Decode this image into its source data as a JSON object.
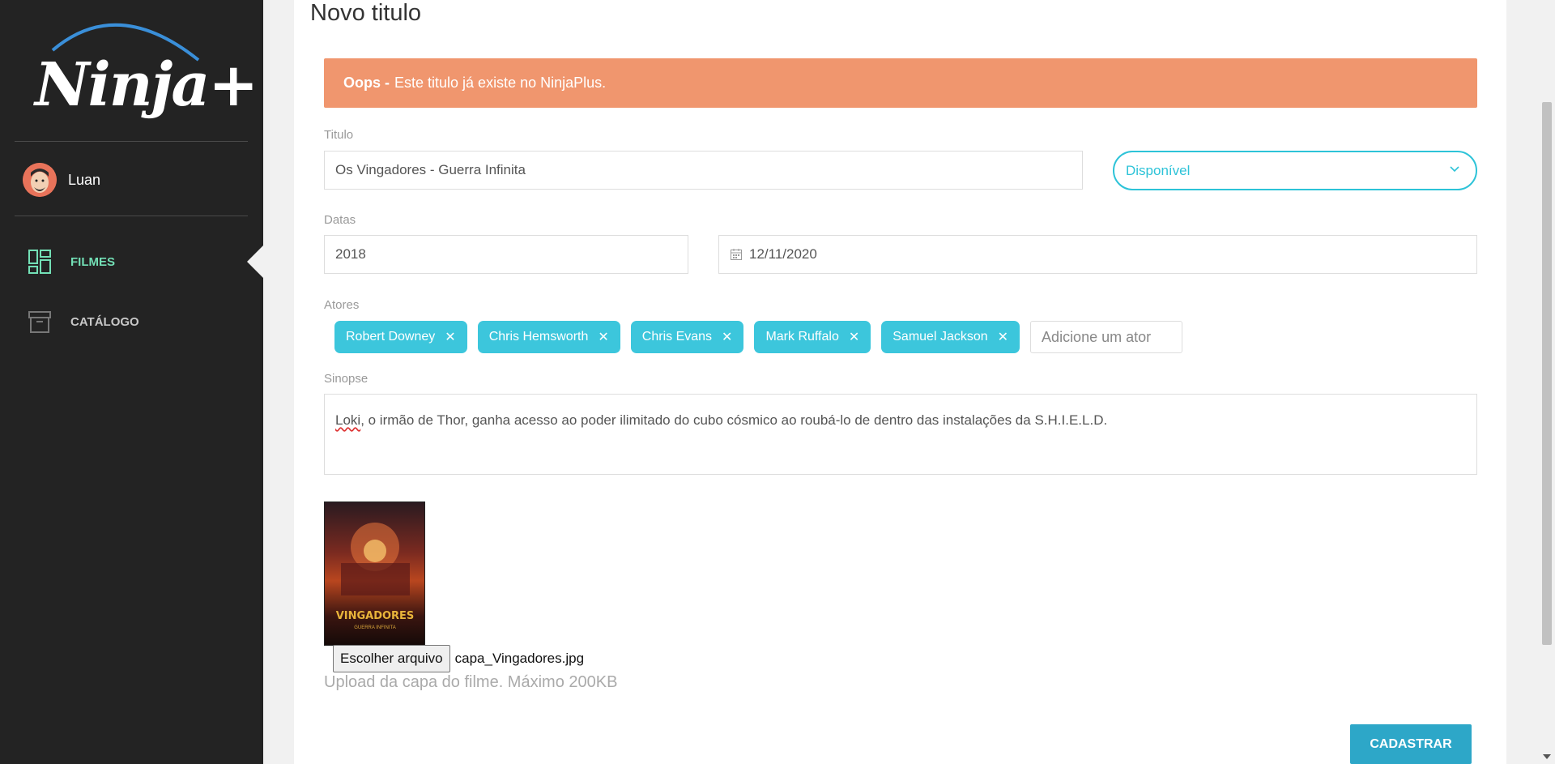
{
  "sidebar": {
    "logo_text": "Ninja+",
    "user_name": "Luan",
    "nav": [
      {
        "label": "FILMES",
        "icon": "dashboard-icon"
      },
      {
        "label": "CATÁLOGO",
        "icon": "archive-box-icon"
      }
    ]
  },
  "main": {
    "title": "Novo titulo",
    "alert": {
      "prefix": "Oops -",
      "message": "Este titulo já existe no NinjaPlus."
    },
    "titulo_label": "Titulo",
    "titulo_value": "Os Vingadores - Guerra Infinita",
    "status_value": "Disponível",
    "datas_label": "Datas",
    "year_value": "2018",
    "date_value": "12/11/2020",
    "atores_label": "Atores",
    "actors": [
      "Robert Downey",
      "Chris Hemsworth",
      "Chris Evans",
      "Mark Ruffalo",
      "Samuel Jackson"
    ],
    "actor_placeholder": "Adicione um ator",
    "sinopse_label": "Sinopse",
    "sinopse_first_word": "Loki",
    "sinopse_rest": ", o irmão de Thor, ganha acesso ao poder ilimitado do cubo cósmico ao roubá-lo de dentro das instalações da S.H.I.E.L.D.",
    "poster_title": "VINGADORES",
    "poster_subtitle": "GUERRA INFINITA",
    "file_button": "Escolher arquivo",
    "file_name": "capa_Vingadores.jpg",
    "upload_help": "Upload da capa do filme. Máximo 200KB",
    "submit_label": "CADASTRAR"
  },
  "colors": {
    "sidebar_bg": "#232323",
    "accent_green": "#73e0b6",
    "accent_cyan": "#2dc3d8",
    "alert_bg": "#f0966e",
    "submit_bg": "#2da7c8"
  }
}
